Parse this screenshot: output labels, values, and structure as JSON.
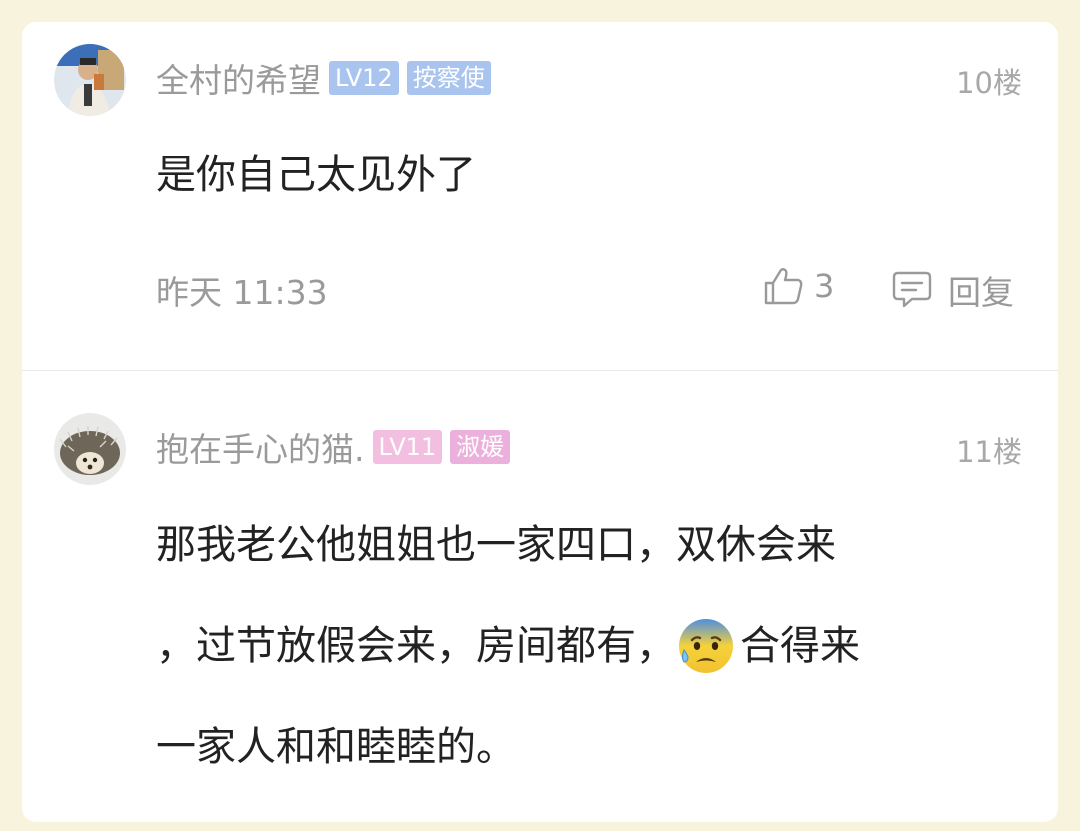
{
  "comments": [
    {
      "username": "全村的希望",
      "level": "LV12",
      "title": "按察使",
      "floor": "10楼",
      "content": "是你自己太见外了",
      "time": "昨天 11:33",
      "likes": "3",
      "reply_label": "回复",
      "avatar_icon": "person-avatar"
    },
    {
      "username": "抱在手心的猫.",
      "level": "LV11",
      "title": "淑媛",
      "floor": "11楼",
      "content_lines": [
        "那我老公他姐姐也一家四口，双休会来",
        "，过节放假会来，房间都有，",
        "一家人和和睦睦的。"
      ],
      "content_after_emoji": "合得来",
      "emoji_icon": "anxious-sweat-face-emoji",
      "avatar_icon": "hedgehog-avatar"
    }
  ],
  "colors": {
    "page_bg": "#f7f3dc",
    "level_blue": "#a9c4ee",
    "level_pink": "#f3bfe0"
  }
}
